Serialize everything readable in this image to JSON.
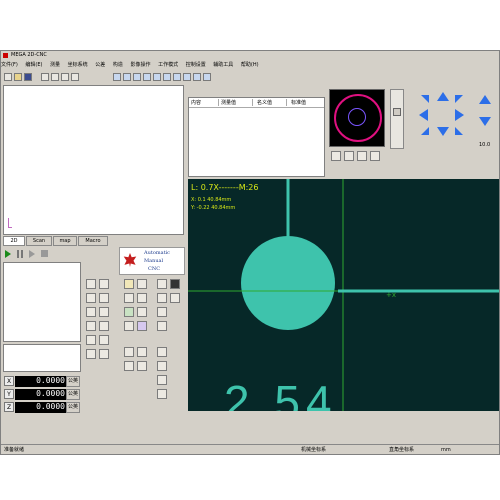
{
  "window": {
    "title": "MEGA 2D-CNC"
  },
  "menu": [
    "文件(F)",
    "编辑(E)",
    "测量",
    "坐标系统",
    "公差",
    "构造",
    "影像操作",
    "工作模式",
    "控制设置",
    "辅助工具",
    "帮助(H)"
  ],
  "tabs": [
    "2D",
    "Scan",
    "map",
    "Macro"
  ],
  "table_headers": [
    "内容",
    "测量值",
    "名义值",
    "标准值"
  ],
  "logo": {
    "line1": "Automatic",
    "line2": "Manual",
    "line3": "CNC"
  },
  "camera": {
    "overlay_line1": "L: 0.7X-------M:26",
    "overlay_line2": "X: 0.1 40.84mm",
    "overlay_line3": "Y: -0.22 40.84mm",
    "crosshair_label": "+x",
    "big_text": "2.54"
  },
  "readouts": [
    {
      "axis": "X",
      "value": "0.0000",
      "unit": "公英"
    },
    {
      "axis": "Y",
      "value": "0.0000",
      "unit": "公英"
    },
    {
      "axis": "Z",
      "value": "0.0000",
      "unit": "公英"
    }
  ],
  "zoom_value": "10.0",
  "status": {
    "left": "准备就绪",
    "coord1": "机械坐标系",
    "coord2": "直角坐标系",
    "unit": "mm"
  },
  "colors": {
    "camera_bg": "#062828",
    "circle": "#3ec3ac",
    "crosshair": "#2fa92f",
    "overlay_text": "#d8e818"
  }
}
